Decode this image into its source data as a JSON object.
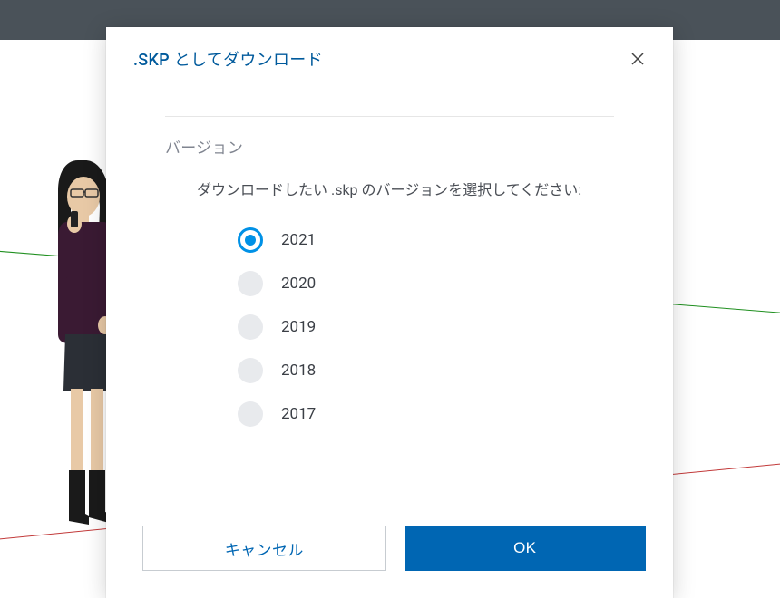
{
  "dialog": {
    "title": ".SKP としてダウンロード",
    "section_label": "バージョン",
    "instruction": "ダウンロードしたい .skp のバージョンを選択してください:",
    "selected": "2021",
    "options": [
      "2021",
      "2020",
      "2019",
      "2018",
      "2017"
    ],
    "cancel_label": "キャンセル",
    "ok_label": "OK"
  },
  "colors": {
    "primary": "#0066b3",
    "accent": "#0091e6",
    "axis_green": "#1f8f1f",
    "axis_red": "#c23a3a"
  }
}
